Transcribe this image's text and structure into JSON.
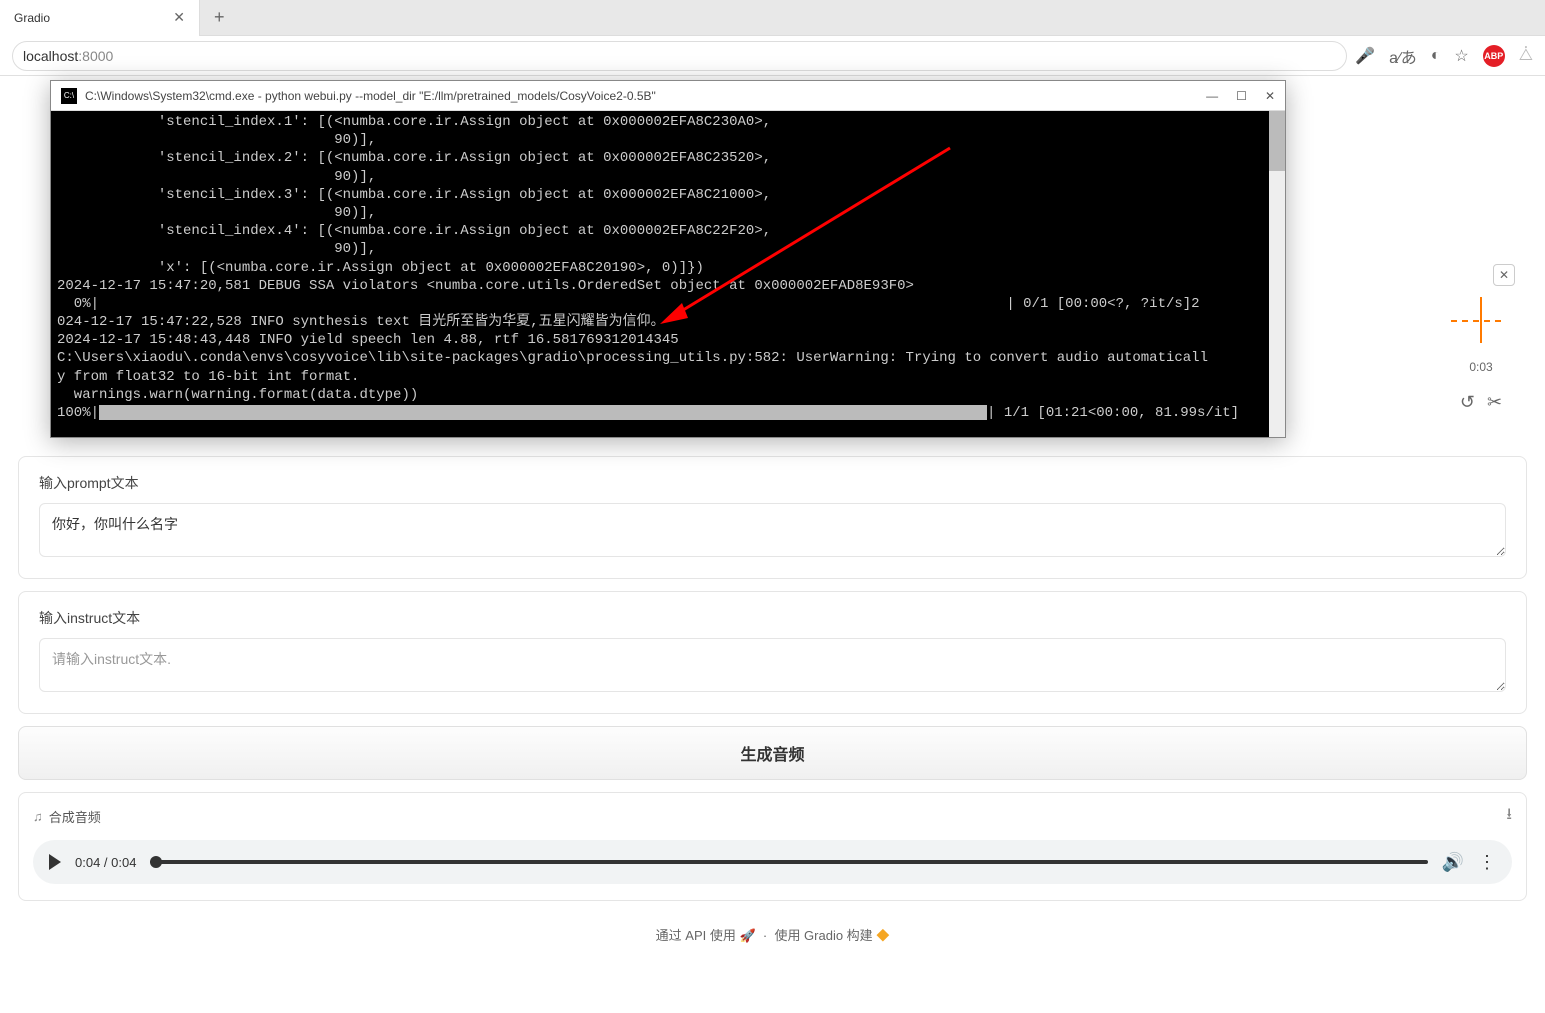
{
  "browser": {
    "tab_title": "Gradio",
    "url_host": "localhost",
    "url_port": ":8000"
  },
  "terminal": {
    "title": "C:\\Windows\\System32\\cmd.exe - python  webui.py --model_dir \"E:/llm/pretrained_models/CosyVoice2-0.5B\"",
    "lines": [
      "            'stencil_index.1': [(<numba.core.ir.Assign object at 0x000002EFA8C230A0>,",
      "                                 90)],",
      "            'stencil_index.2': [(<numba.core.ir.Assign object at 0x000002EFA8C23520>,",
      "                                 90)],",
      "            'stencil_index.3': [(<numba.core.ir.Assign object at 0x000002EFA8C21000>,",
      "                                 90)],",
      "            'stencil_index.4': [(<numba.core.ir.Assign object at 0x000002EFA8C22F20>,",
      "                                 90)],",
      "            'x': [(<numba.core.ir.Assign object at 0x000002EFA8C20190>, 0)]})",
      "2024-12-17 15:47:20,581 DEBUG SSA violators <numba.core.utils.OrderedSet object at 0x000002EFAD8E93F0>",
      "  0%|                                                                                                            | 0/1 [00:00<?, ?it/s]2",
      "024-12-17 15:47:22,528 INFO synthesis text 目光所至皆为华夏,五星闪耀皆为信仰。",
      "2024-12-17 15:48:43,448 INFO yield speech len 4.88, rtf 16.581769312014345",
      "C:\\Users\\xiaodu\\.conda\\envs\\cosyvoice\\lib\\site-packages\\gradio\\processing_utils.py:582: UserWarning: Trying to convert audio automaticall",
      "y from float32 to 16-bit int format.",
      "  warnings.warn(warning.format(data.dtype))"
    ],
    "progress_prefix": "100%|",
    "progress_suffix": "| 1/1 [01:21<00:00, 81.99s/it]"
  },
  "prompt": {
    "label": "输入prompt文本",
    "value": "你好，你叫什么名字"
  },
  "instruct": {
    "label": "输入instruct文本",
    "placeholder": "请输入instruct文本."
  },
  "generate_btn": "生成音频",
  "audio_out": {
    "label": "合成音频",
    "time": "0:04 / 0:04"
  },
  "right_panel": {
    "time": "0:03"
  },
  "footer": {
    "api_text": "通过 API 使用",
    "built_text": "使用 Gradio 构建"
  }
}
